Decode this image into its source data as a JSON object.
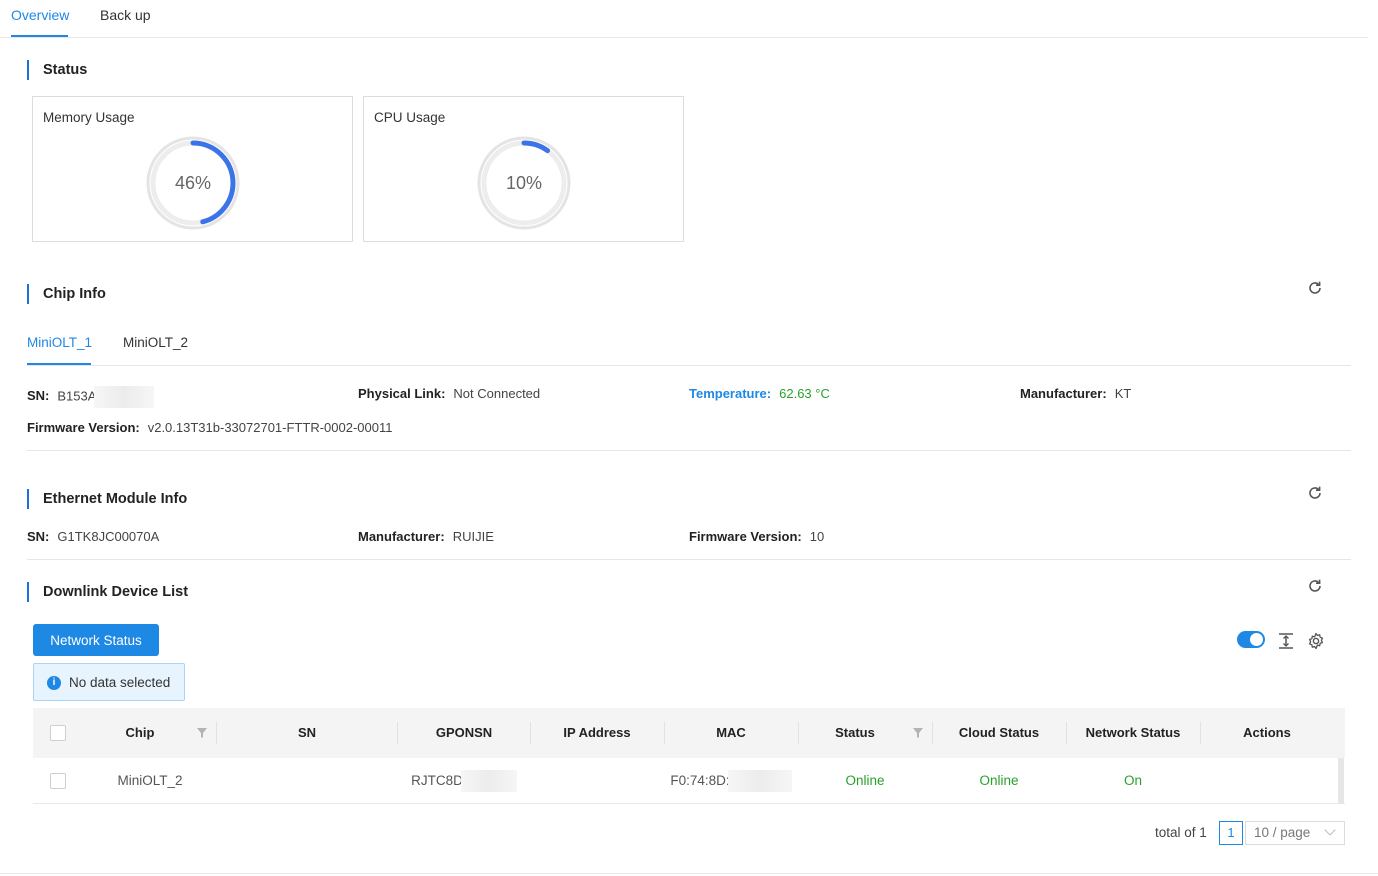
{
  "top_tabs": {
    "overview": "Overview",
    "backup": "Back up"
  },
  "status": {
    "title": "Status",
    "memory": {
      "label": "Memory Usage",
      "value_text": "46%",
      "value": 46
    },
    "cpu": {
      "label": "CPU Usage",
      "value_text": "10%",
      "value": 10
    }
  },
  "chip_info": {
    "title": "Chip Info",
    "tabs": [
      "MiniOLT_1",
      "MiniOLT_2"
    ],
    "sn_label": "SN:",
    "sn_value": "B153A",
    "physical_link_label": "Physical Link:",
    "physical_link_value": "Not Connected",
    "temperature_label": "Temperature:",
    "temperature_value": "62.63 °C",
    "manufacturer_label": "Manufacturer:",
    "manufacturer_value": "KT",
    "firmware_label": "Firmware Version:",
    "firmware_value": "v2.0.13T31b-33072701-FTTR-0002-00011"
  },
  "ethernet": {
    "title": "Ethernet Module Info",
    "sn_label": "SN:",
    "sn_value": "G1TK8JC00070A",
    "manufacturer_label": "Manufacturer:",
    "manufacturer_value": "RUIJIE",
    "firmware_label": "Firmware Version:",
    "firmware_value": "10"
  },
  "downlink": {
    "title": "Downlink Device List",
    "network_status_button": "Network Status",
    "no_data_text": "No data selected",
    "columns": [
      "Chip",
      "SN",
      "GPONSN",
      "IP Address",
      "MAC",
      "Status",
      "Cloud Status",
      "Network Status",
      "Actions"
    ],
    "rows": [
      {
        "chip": "MiniOLT_2",
        "sn": "",
        "gponsn": "RJTC8D",
        "ip": "",
        "mac": "F0:74:8D:",
        "status": "Online",
        "cloud_status": "Online",
        "network_status": "On",
        "actions": ""
      }
    ],
    "pagination": {
      "total": "total of 1",
      "page": "1",
      "page_size": "10 / page"
    }
  },
  "colors": {
    "accent": "#1e88e5",
    "online": "#2aa12a"
  },
  "icons": [
    "refresh-icon",
    "info-icon",
    "filter-icon",
    "column-height-icon",
    "gear-icon",
    "chevron-down-icon"
  ]
}
